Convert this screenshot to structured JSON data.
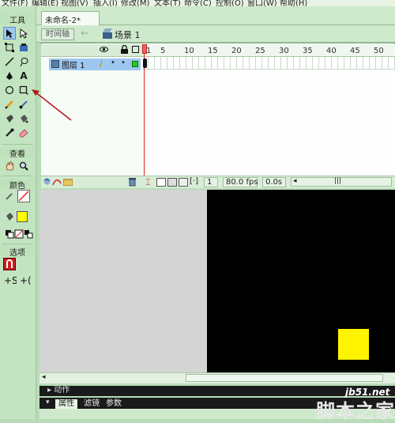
{
  "menu": [
    "文件(F)",
    "编辑(E)",
    "视图(V)",
    "插入(I)",
    "修改(M)",
    "文本(T)",
    "命令(C)",
    "控制(O)",
    "窗口(W)",
    "帮助(H)"
  ],
  "tools": {
    "header": "工具",
    "view_header": "查看",
    "color_header": "颜色",
    "options_header": "选项",
    "icons": [
      "selection-tool-icon",
      "subselection-tool-icon",
      "free-transform-icon",
      "gradient-transform-icon",
      "line-tool-icon",
      "lasso-tool-icon",
      "pen-tool-icon",
      "text-tool-icon",
      "oval-tool-icon",
      "rectangle-tool-icon",
      "pencil-tool-icon",
      "brush-tool-icon",
      "ink-bottle-icon",
      "paint-bucket-icon",
      "eyedropper-icon",
      "eraser-icon",
      "hand-tool-icon",
      "zoom-tool-icon"
    ],
    "fill_color": "#ffff00"
  },
  "document": {
    "tab_title": "未命名-2*",
    "timeline_button": "时间轴",
    "scene_label": "场景 1"
  },
  "timeline": {
    "layer_name": "图层 1",
    "frame_marks": [
      "1",
      "5",
      "10",
      "15",
      "20",
      "25",
      "30",
      "35",
      "40",
      "45",
      "50"
    ],
    "current_frame": "1",
    "frame_rate": "80.0 fps",
    "elapsed": "0.0s"
  },
  "stage": {
    "background": "#000000",
    "rect_color": "#fff400"
  },
  "panels": {
    "actions": "动作",
    "tabs": [
      "属性",
      "滤镜",
      "参数"
    ]
  },
  "watermark": {
    "url": "jb51.net",
    "text": "脚本之家"
  }
}
